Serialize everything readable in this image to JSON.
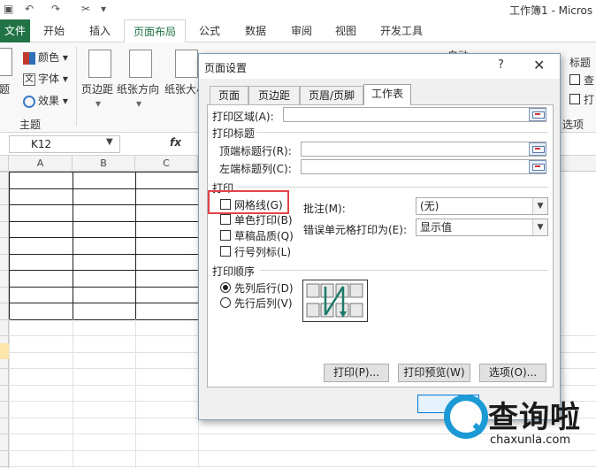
{
  "window": {
    "title": "工作簿1 - Micros"
  },
  "ribbon_tabs": [
    {
      "label": "文件"
    },
    {
      "label": "开始"
    },
    {
      "label": "插入"
    },
    {
      "label": "页面布局"
    },
    {
      "label": "公式"
    },
    {
      "label": "数据"
    },
    {
      "label": "审阅"
    },
    {
      "label": "视图"
    },
    {
      "label": "开发工具"
    }
  ],
  "ribbon": {
    "theme_group": {
      "title": "主题",
      "themes_btn": "题",
      "colors": "颜色",
      "fonts": "字体",
      "effects": "效果"
    },
    "page_setup": {
      "margins": "页边距",
      "orientation": "纸张方向",
      "size": "纸张大小"
    },
    "sheet_options": {
      "title_label": "标题",
      "options_label": "选项"
    },
    "partial_labels": [
      "查",
      "打",
      "自动"
    ]
  },
  "formula_bar": {
    "name_box": "K12",
    "fx": "fx"
  },
  "sheet": {
    "columns": [
      "A",
      "B",
      "C"
    ]
  },
  "dialog": {
    "title": "页面设置",
    "help": "?",
    "close": "✕",
    "tabs": [
      {
        "label": "页面",
        "active": false
      },
      {
        "label": "页边距",
        "active": false
      },
      {
        "label": "页眉/页脚",
        "active": false
      },
      {
        "label": "工作表",
        "active": true
      }
    ],
    "print_area_label": "打印区域(A):",
    "print_titles_section": "打印标题",
    "top_rows_label": "顶端标题行(R):",
    "left_cols_label": "左端标题列(C):",
    "print_section": "打印",
    "checkboxes": [
      {
        "label": "网格线(G)",
        "checked": false
      },
      {
        "label": "单色打印(B)",
        "checked": false
      },
      {
        "label": "草稿品质(Q)",
        "checked": false
      },
      {
        "label": "行号列标(L)",
        "checked": false
      }
    ],
    "comments_label": "批注(M):",
    "comments_value": "(无)",
    "errors_label": "错误单元格打印为(E):",
    "errors_value": "显示值",
    "order_section": "打印顺序",
    "order_options": [
      {
        "label": "先列后行(D)",
        "selected": true
      },
      {
        "label": "先行后列(V)",
        "selected": false
      }
    ],
    "buttons": {
      "print": "打印(P)...",
      "preview": "打印预览(W)",
      "options": "选项(O)..."
    }
  },
  "watermark": {
    "cn": "查询啦",
    "en": "chaxunla.com"
  },
  "colors": {
    "accent": "#217346",
    "highlight": "#e2434a",
    "watermark": "#1b9ad6"
  }
}
